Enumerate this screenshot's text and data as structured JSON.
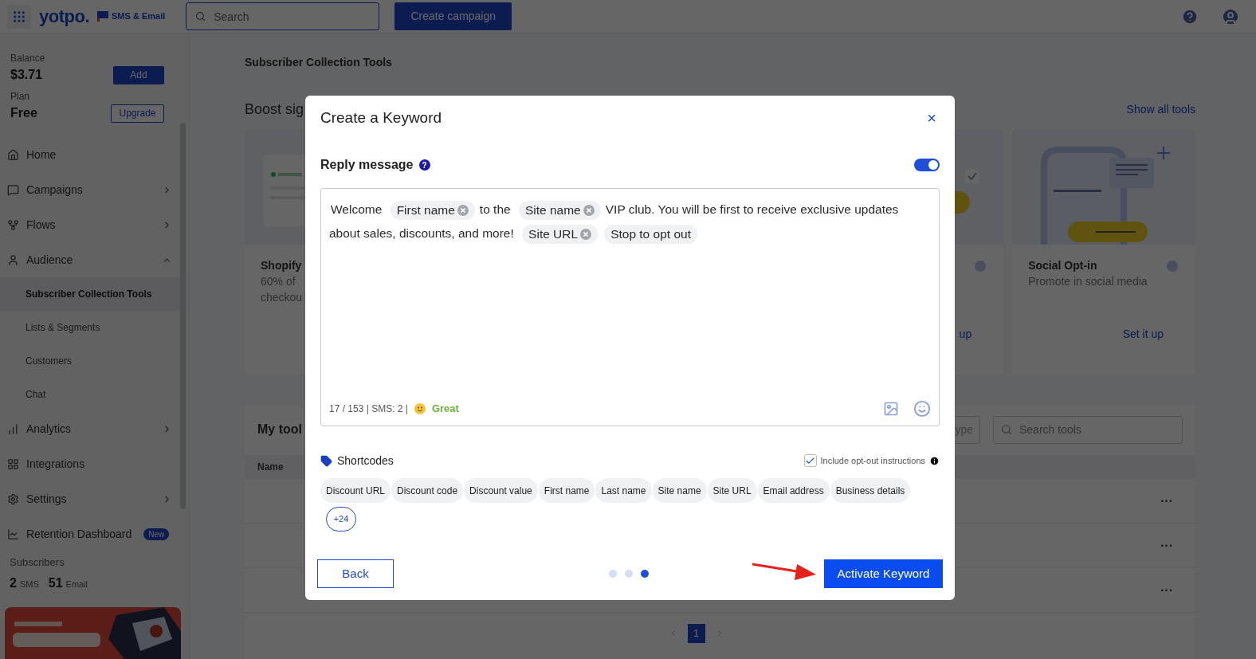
{
  "top_bar": {
    "brand": "yotpo.",
    "product": "SMS & Email",
    "search": {
      "placeholder": "Search"
    },
    "create_button": "Create campaign"
  },
  "sidebar": {
    "balance": {
      "label": "Balance",
      "value": "$3.71",
      "button": "Add"
    },
    "plan": {
      "label": "Plan",
      "value": "Free",
      "button": "Upgrade"
    },
    "items": [
      {
        "label": "Home",
        "selected": false
      },
      {
        "label": "Campaigns",
        "selected": false,
        "expanded": false
      },
      {
        "label": "Flows",
        "selected": false,
        "expanded": false
      },
      {
        "label": "Audience",
        "selected": false,
        "expanded": true,
        "children": [
          {
            "label": "Subscriber Collection Tools",
            "selected": true
          },
          {
            "label": "Lists & Segments",
            "selected": false
          },
          {
            "label": "Customers",
            "selected": false
          },
          {
            "label": "Chat",
            "selected": false
          }
        ]
      },
      {
        "label": "Analytics",
        "selected": false,
        "expanded": false
      },
      {
        "label": "Integrations",
        "selected": false
      },
      {
        "label": "Settings",
        "selected": false,
        "expanded": false
      },
      {
        "label": "Retention Dashboard",
        "selected": false,
        "badge": "New"
      }
    ],
    "subscribers": {
      "label": "Subscribers",
      "sms_count": "2",
      "sms_label": "SMS",
      "email_count": "51",
      "email_label": "Email"
    }
  },
  "main": {
    "heading": "Subscriber Collection Tools",
    "section_title": "Boost sig",
    "show_all": "Show all tools",
    "cards": [
      {
        "title": "Shopify",
        "description": [
          "60% of",
          "checkou"
        ]
      },
      {
        "link": "up"
      },
      {
        "title": "Social Opt-in",
        "description": [
          "Promote in social media"
        ],
        "link": "Set it up"
      }
    ],
    "my_tools": {
      "title": "My tool",
      "type_filter": "ype",
      "search": {
        "placeholder": "Search tools"
      },
      "columns": [
        "Name"
      ],
      "rows": [
        {
          "menu": "···"
        },
        {
          "menu": "···"
        },
        {
          "menu": "···"
        }
      ]
    },
    "pagination": [
      {
        "label": "1",
        "selected": true
      }
    ]
  },
  "modal": {
    "title": "Create a Keyword",
    "close": "×",
    "reply": {
      "label": "Reply message",
      "help": "?",
      "enabled": true
    },
    "message": [
      {
        "kind": "text",
        "text": "Welcome"
      },
      {
        "kind": "tag",
        "text": "First name",
        "removable": true
      },
      {
        "kind": "text",
        "text": "to the"
      },
      {
        "kind": "tag",
        "text": "Site name",
        "removable": true
      },
      {
        "kind": "text",
        "text": "VIP club. You will be first to receive exclusive updates about sales, discounts, and more!"
      },
      {
        "kind": "tag",
        "text": "Site URL",
        "removable": true
      },
      {
        "kind": "tag",
        "text": "Stop to opt out",
        "removable": false
      }
    ],
    "counter": "17 / 153 | SMS: 2 |",
    "quality": "Great",
    "shortcodes": {
      "label": "Shortcodes",
      "opt_out": {
        "label": "Include opt-out instructions",
        "checked": true
      },
      "items": [
        "Discount URL",
        "Discount code",
        "Discount value",
        "First name",
        "Last name",
        "Site name",
        "Site URL",
        "Email address",
        "Business details"
      ],
      "more": "+24"
    },
    "back": "Back",
    "steps": [
      {
        "selected": false
      },
      {
        "selected": false
      },
      {
        "selected": true
      }
    ],
    "activate": "Activate Keyword"
  }
}
